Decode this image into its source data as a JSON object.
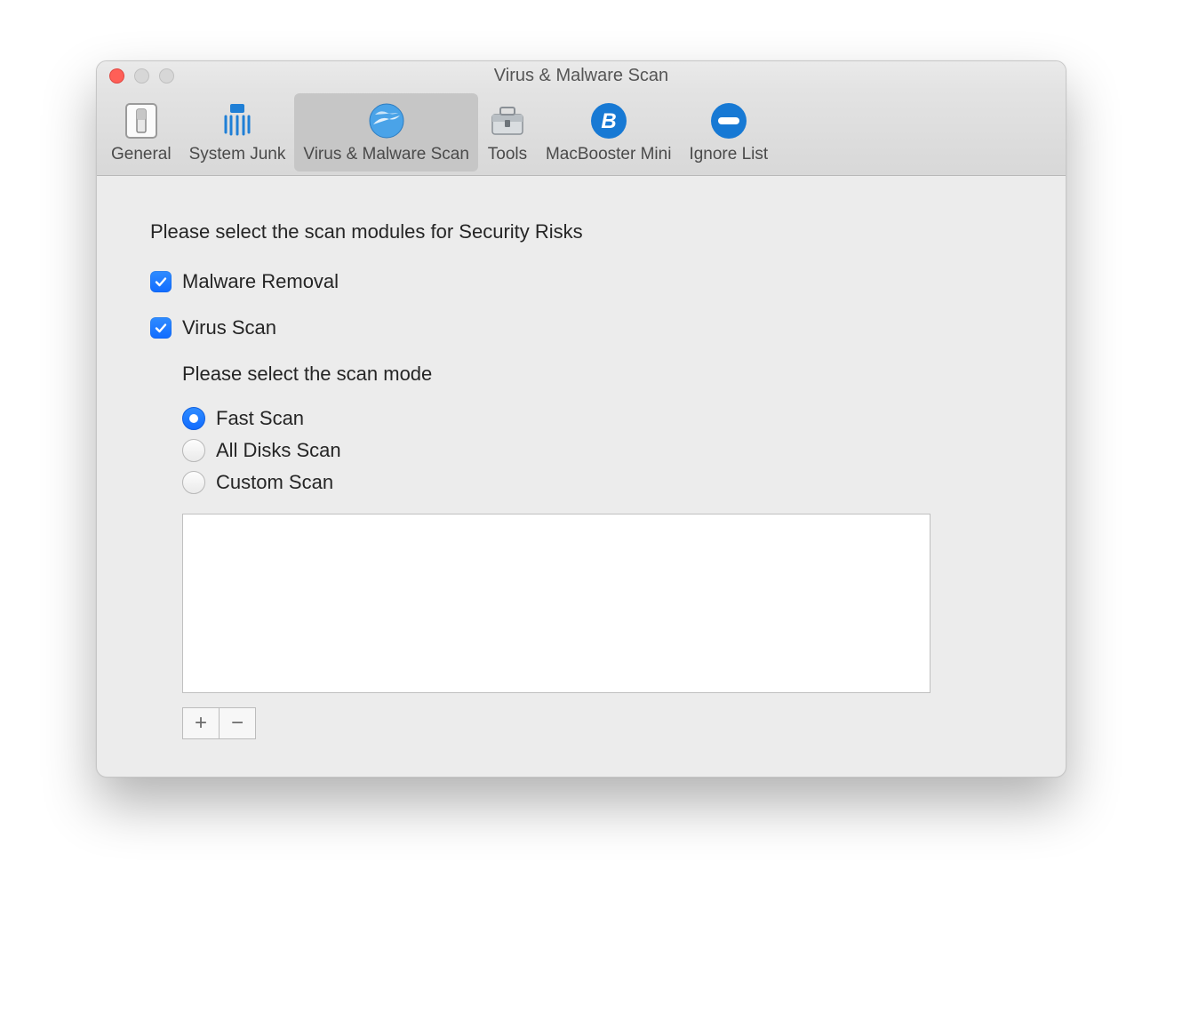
{
  "window": {
    "title": "Virus & Malware Scan"
  },
  "tabs": [
    {
      "label": "General"
    },
    {
      "label": "System Junk"
    },
    {
      "label": "Virus & Malware Scan",
      "active": true
    },
    {
      "label": "Tools"
    },
    {
      "label": "MacBooster Mini"
    },
    {
      "label": "Ignore List"
    }
  ],
  "content": {
    "intro": "Please select the scan modules for Security Risks",
    "checks": {
      "malware_removal": {
        "label": "Malware Removal",
        "checked": true
      },
      "virus_scan": {
        "label": "Virus Scan",
        "checked": true
      }
    },
    "scan_mode_heading": "Please select the scan mode",
    "radios": {
      "fast": {
        "label": "Fast Scan",
        "selected": true
      },
      "all": {
        "label": "All Disks Scan",
        "selected": false
      },
      "custom": {
        "label": "Custom Scan",
        "selected": false
      }
    },
    "buttons": {
      "add": "+",
      "remove": "−"
    }
  }
}
